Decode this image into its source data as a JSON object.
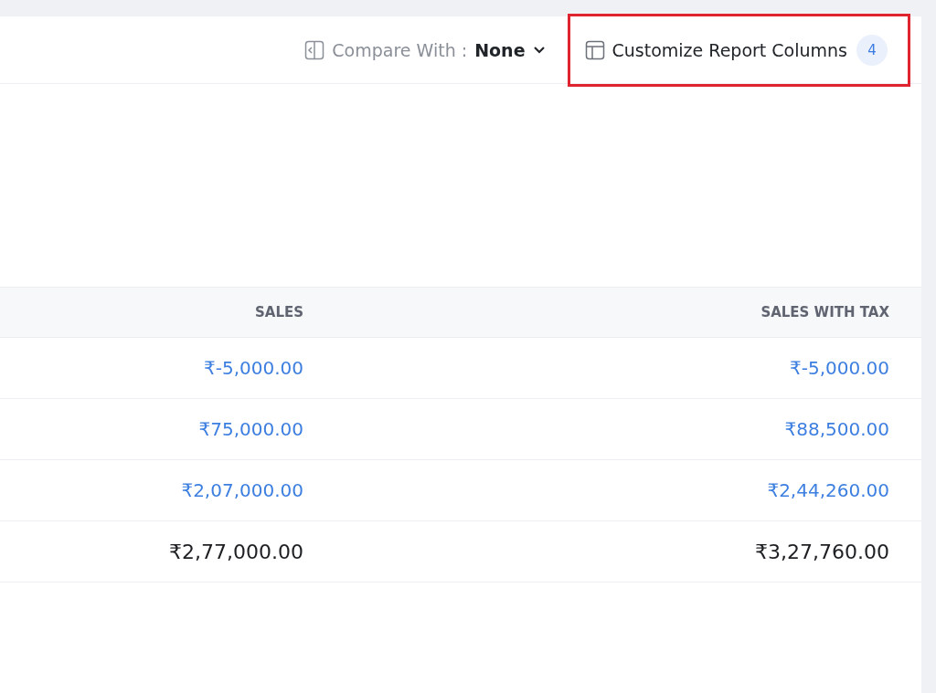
{
  "toolbar": {
    "compare": {
      "label": "Compare With :",
      "value": "None"
    },
    "customize": {
      "label": "Customize Report Columns",
      "count": "4",
      "highlighted": true
    }
  },
  "table": {
    "columns": [
      "SALES",
      "SALES WITH TAX"
    ],
    "rows": [
      {
        "kind": "link",
        "cells": [
          "₹-5,000.00",
          "₹-5,000.00"
        ]
      },
      {
        "kind": "link",
        "cells": [
          "₹75,000.00",
          "₹88,500.00"
        ]
      },
      {
        "kind": "link",
        "cells": [
          "₹2,07,000.00",
          "₹2,44,260.00"
        ]
      },
      {
        "kind": "total",
        "cells": [
          "₹2,77,000.00",
          "₹3,27,760.00"
        ]
      }
    ]
  }
}
